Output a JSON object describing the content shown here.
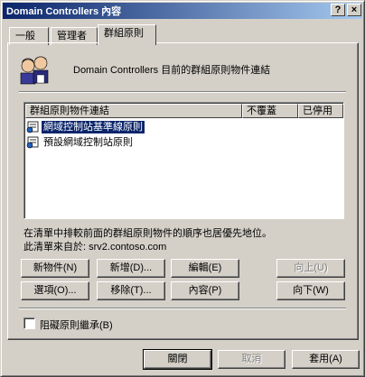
{
  "window": {
    "title": "Domain Controllers 內容",
    "help_button": "?",
    "close_button": "×"
  },
  "tabs": [
    {
      "label": "一般",
      "active": false
    },
    {
      "label": "管理者",
      "active": false
    },
    {
      "label": "群組原則",
      "active": true
    }
  ],
  "header": {
    "text": "Domain Controllers 目前的群組原則物件連結",
    "icon": "users-icon"
  },
  "list": {
    "columns": [
      "群組原則物件連結",
      "不覆蓋",
      "已停用"
    ],
    "rows": [
      {
        "name": "網域控制站基準線原則",
        "selected": true,
        "icon": "gpo-scroll-icon"
      },
      {
        "name": "預設網域控制站原則",
        "selected": false,
        "icon": "gpo-scroll-icon"
      }
    ]
  },
  "info": {
    "line1": "在清單中排較前面的群組原則物件的順序也居優先地位。",
    "line2": "此清單來自於: srv2.contoso.com"
  },
  "buttons": {
    "new": "新物件(N)",
    "add": "新增(D)...",
    "edit": "編輯(E)",
    "up": "向上(U)",
    "options": "選項(O)...",
    "remove": "移除(T)...",
    "properties": "內容(P)",
    "down": "向下(W)"
  },
  "block_inheritance": {
    "label": "阻礙原則繼承(B)",
    "checked": false
  },
  "footer": {
    "close": "關閉",
    "cancel": "取消",
    "apply": "套用(A)"
  }
}
